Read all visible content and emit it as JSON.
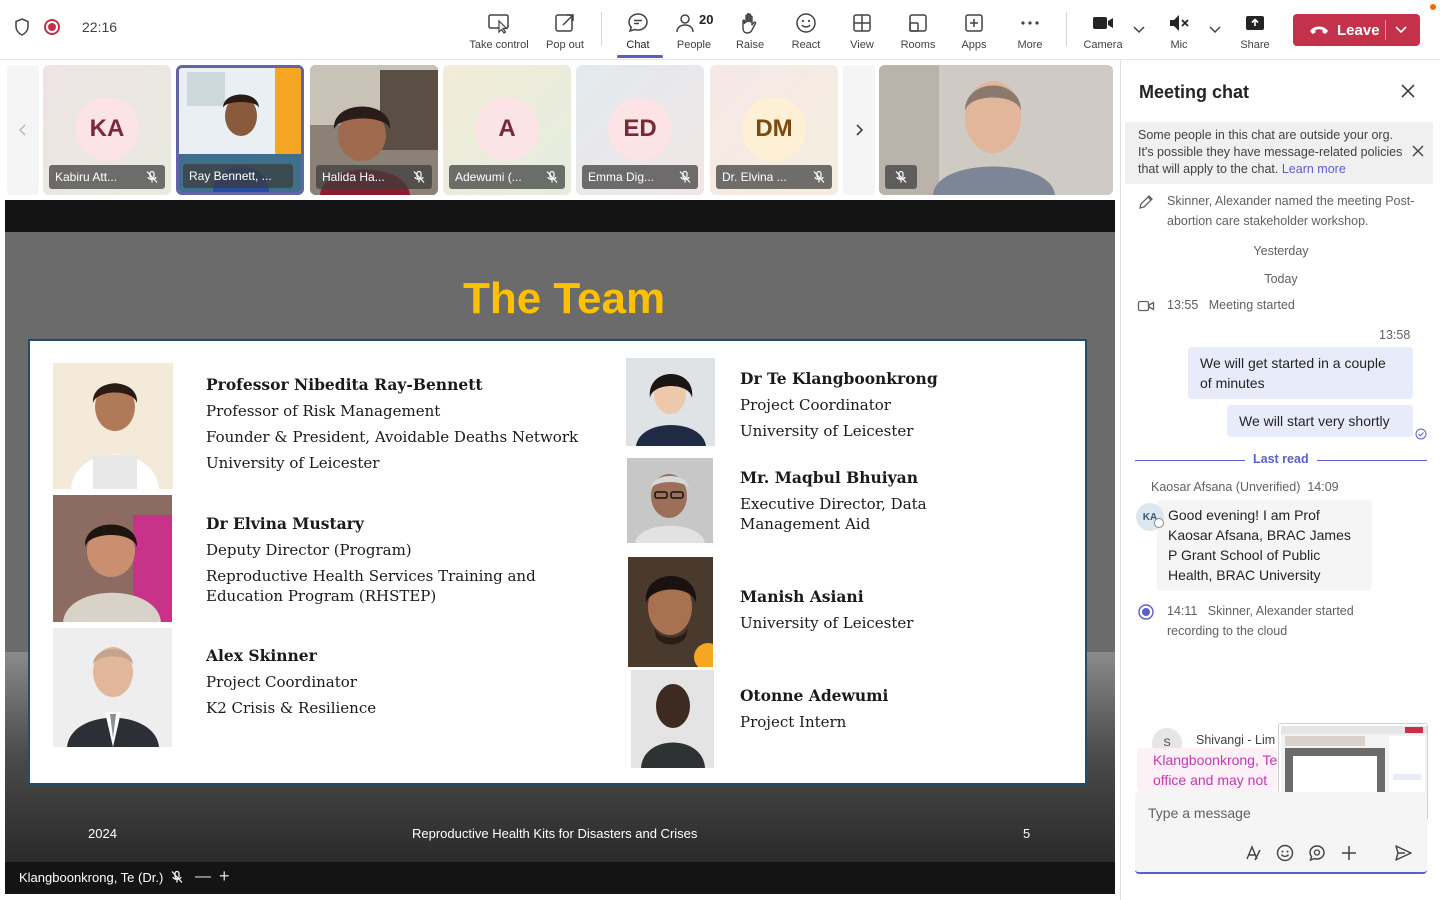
{
  "topbar": {
    "time": "22:16",
    "buttons": {
      "take_control": "Take control",
      "pop_out": "Pop out",
      "chat": "Chat",
      "people": "People",
      "people_count": "20",
      "raise": "Raise",
      "react": "React",
      "view": "View",
      "rooms": "Rooms",
      "apps": "Apps",
      "more": "More",
      "camera": "Camera",
      "mic": "Mic",
      "share": "Share",
      "leave": "Leave"
    }
  },
  "participants": [
    {
      "initials": "KA",
      "name": "Kabiru Att...",
      "avatar_bg": "#fbe3e6",
      "avatar_fg": "#7a2a36"
    },
    {
      "initials": "",
      "name": "Ray Bennett, ...",
      "selected": true
    },
    {
      "initials": "",
      "name": "Halida Ha..."
    },
    {
      "initials": "A",
      "name": "Adewumi (...",
      "avatar_bg": "#fbe3e6",
      "avatar_fg": "#7a2a36"
    },
    {
      "initials": "ED",
      "name": "Emma Dig...",
      "avatar_bg": "#fbe3e6",
      "avatar_fg": "#7a2a36"
    },
    {
      "initials": "DM",
      "name": "Dr. Elvina ...",
      "avatar_bg": "#fdf0d5",
      "avatar_fg": "#7a4a10"
    }
  ],
  "slide": {
    "title": "The Team",
    "left_people": [
      {
        "name": "Professor Nibedita Ray-Bennett",
        "lines": [
          "Professor of Risk Management",
          "Founder & President, Avoidable Deaths Network",
          "University of Leicester"
        ]
      },
      {
        "name": "Dr Elvina Mustary",
        "lines": [
          "Deputy Director (Program)",
          "Reproductive Health Services Training and Education Program (RHSTEP)"
        ]
      },
      {
        "name": "Alex Skinner",
        "lines": [
          "Project Coordinator",
          "K2 Crisis & Resilience"
        ]
      }
    ],
    "right_people": [
      {
        "name": "Dr Te Klangboonkrong",
        "lines": [
          "Project Coordinator",
          "University of Leicester"
        ]
      },
      {
        "name": "Mr. Maqbul Bhuiyan",
        "lines": [
          "Executive Director, Data Management Aid"
        ]
      },
      {
        "name": "Manish Asiani",
        "lines": [
          "University of Leicester"
        ]
      },
      {
        "name": "Otonne Adewumi",
        "lines": [
          "Project Intern"
        ]
      }
    ],
    "footer_year": "2024",
    "footer_title": "Reproductive Health Kits for Disasters and Crises",
    "footer_page": "5"
  },
  "presenter_name": "Klangboonkrong, Te (Dr.)",
  "chat": {
    "title": "Meeting chat",
    "banner_text": "Some people in this chat are outside your org. It's possible they have message-related policies that will apply to the chat.",
    "banner_link": "Learn more",
    "rename_event": "Skinner, Alexander named the meeting Post-abortion care stakeholder workshop.",
    "date_yesterday": "Yesterday",
    "date_today": "Today",
    "meeting_started_time": "13:55",
    "meeting_started_text": "Meeting started",
    "my_time": "13:58",
    "my_msg_1": "We will get started in a couple of minutes",
    "my_msg_2": "We will start very shortly",
    "last_read": "Last read",
    "sender_name": "Kaosar Afsana (Unverified)",
    "sender_time": "14:09",
    "sender_initials": "KA",
    "sender_msg": "Good evening! I am Prof Kaosar Afsana, BRAC James P Grant School of Public Health, BRAC University",
    "rec_time": "14:11",
    "rec_text": "Skinner, Alexander started recording to the cloud",
    "next_initials": "S",
    "next_name": "Shivangi - Lim",
    "pink_line_1": "Klangboonkrong, Te",
    "pink_line_2": "office and may not",
    "compose_placeholder": "Type a message"
  }
}
